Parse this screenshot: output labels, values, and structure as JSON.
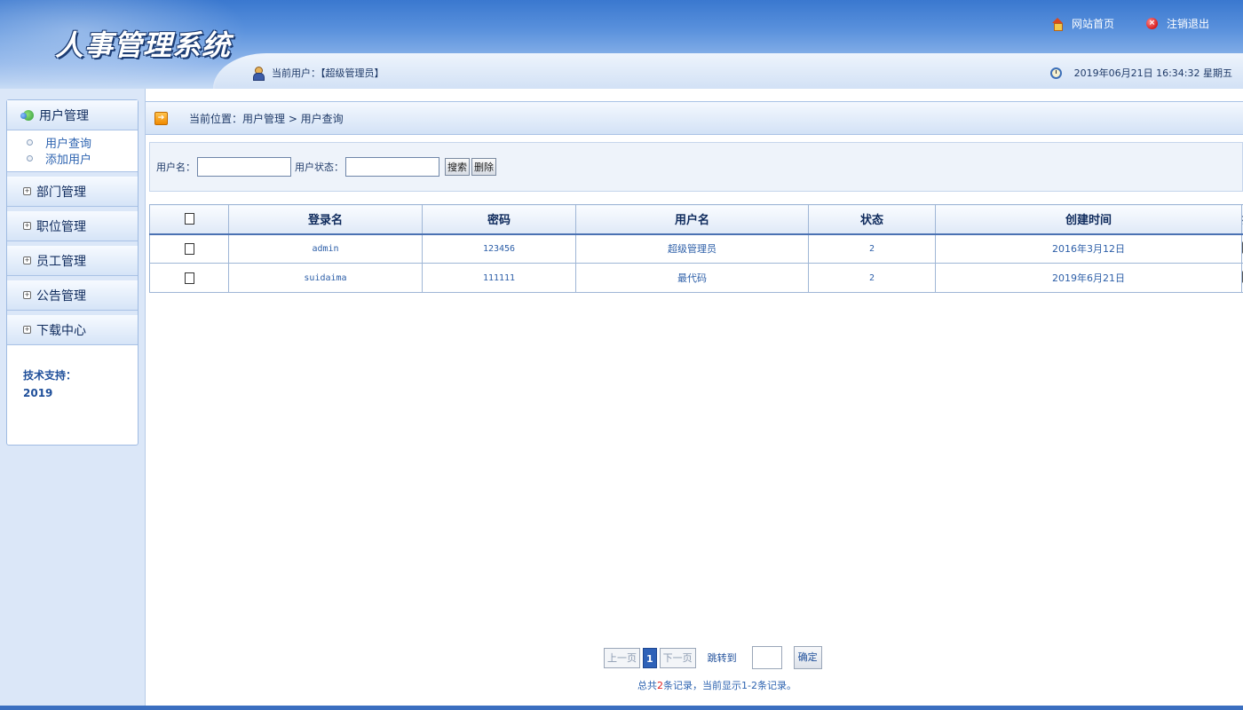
{
  "header": {
    "title": "人事管理系统",
    "home_link": "网站首页",
    "logout_link": "注销退出",
    "current_user": "当前用户：【超级管理员】",
    "datetime": "2019年06月21日 16:34:32 星期五"
  },
  "sidebar": {
    "menus": [
      {
        "label": "用户管理",
        "expanded": true,
        "items": [
          "用户查询",
          "添加用户"
        ]
      },
      {
        "label": "部门管理"
      },
      {
        "label": "职位管理"
      },
      {
        "label": "员工管理"
      },
      {
        "label": "公告管理"
      },
      {
        "label": "下载中心"
      }
    ],
    "tech_label": "技术支持：",
    "tech_year": "2019"
  },
  "breadcrumb": "当前位置：用户管理 > 用户查询",
  "search": {
    "username_label": "用户名：",
    "username_value": "",
    "status_label": "用户状态：",
    "status_value": "",
    "search_button": "搜索",
    "delete_button": "删除"
  },
  "table": {
    "headers": [
      "登录名",
      "密码",
      "用户名",
      "状态",
      "创建时间",
      "操"
    ],
    "rows": [
      {
        "login": "admin",
        "password": "123456",
        "username": "超级管理员",
        "status": "2",
        "created": "2016年3月12日"
      },
      {
        "login": "suidaima",
        "password": "111111",
        "username": "最代码",
        "status": "2",
        "created": "2019年6月21日"
      }
    ]
  },
  "pager": {
    "prev": "上一页",
    "current": "1",
    "next": "下一页",
    "jump_label": "跳转到",
    "jump_value": "",
    "ok": "确定",
    "info_prefix": "总共",
    "total": "2",
    "info_suffix": "条记录，当前显示1-2条记录。"
  },
  "colors": {
    "header_blue": "#3a78cf",
    "link_blue": "#2d63b0",
    "pager_current": "#2f62b8",
    "highlight_red": "#e02020"
  }
}
